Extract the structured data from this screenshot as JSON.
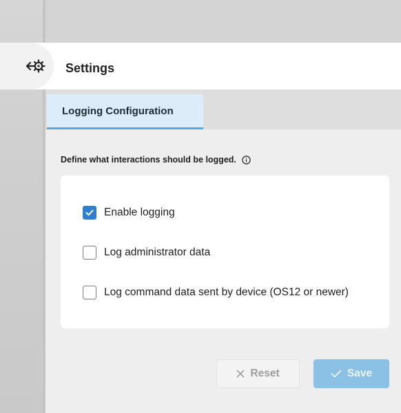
{
  "header": {
    "title": "Settings",
    "icon": "settings-arrows-icon"
  },
  "tabs": [
    {
      "label": "Logging Configuration",
      "active": true
    }
  ],
  "section": {
    "description": "Define what interactions should be logged.",
    "info_icon": "info-icon"
  },
  "options": [
    {
      "label": "Enable logging",
      "checked": true
    },
    {
      "label": "Log administrator data",
      "checked": false
    },
    {
      "label": "Log command data sent by device (OS12 or newer)",
      "checked": false
    }
  ],
  "buttons": {
    "reset_label": "Reset",
    "reset_icon": "close-icon",
    "reset_disabled": true,
    "save_label": "Save",
    "save_icon": "check-icon",
    "save_disabled": true
  },
  "colors": {
    "accent": "#2f7fd0",
    "tab_active_bg": "#dcecf8",
    "tab_underline": "#5aa6df",
    "save_disabled_bg": "#8cc1e6"
  }
}
